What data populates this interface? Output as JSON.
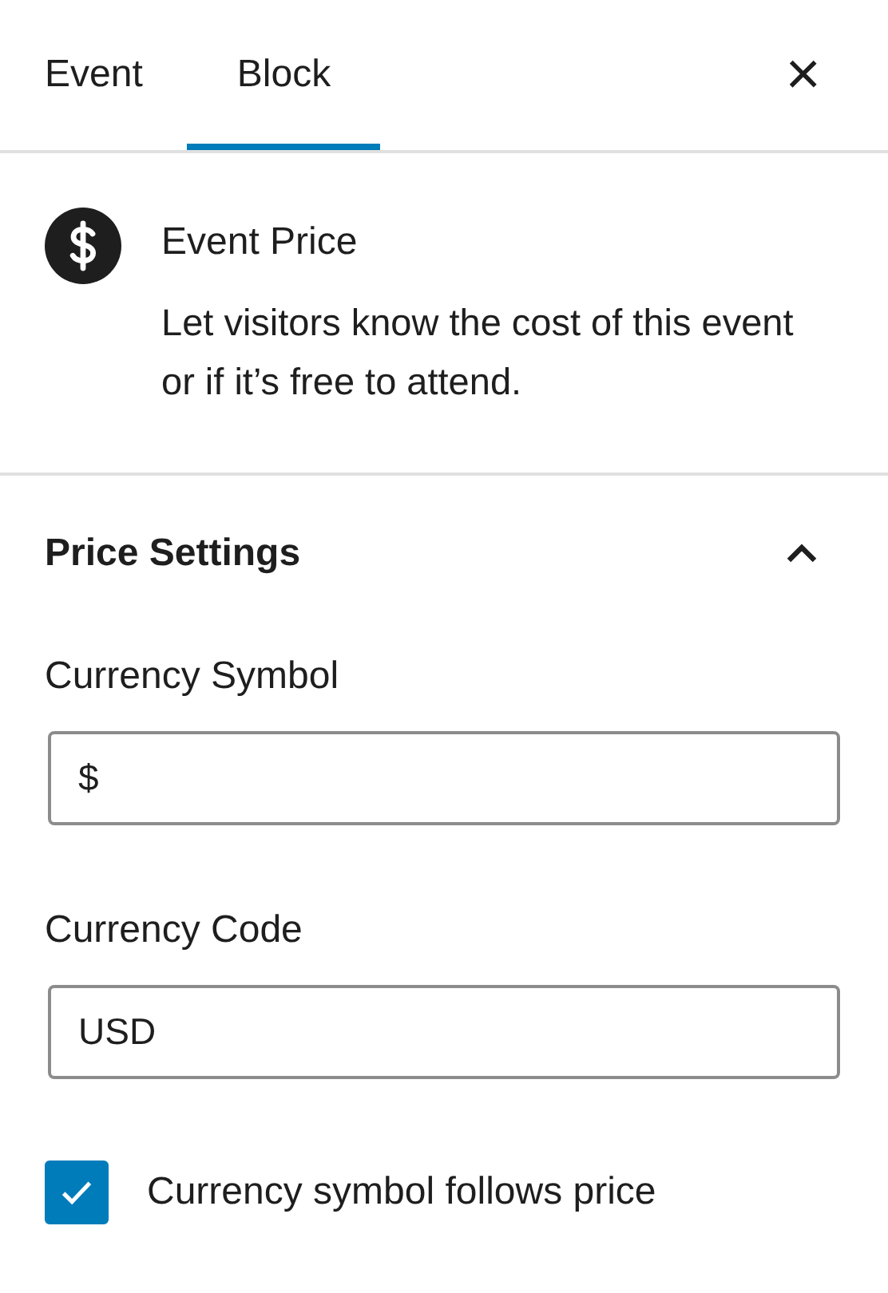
{
  "tabs": [
    {
      "label": "Event",
      "selected": false
    },
    {
      "label": "Block",
      "selected": true
    }
  ],
  "close": {
    "glyph": "×"
  },
  "block": {
    "title": "Event Price",
    "description": "Let visitors know the cost of this event or if it’s free to attend."
  },
  "panel": {
    "title": "Price Settings",
    "expanded": true,
    "fields": [
      {
        "label": "Currency Symbol",
        "value": "$"
      },
      {
        "label": "Currency Code",
        "value": "USD"
      }
    ],
    "checkbox": {
      "label": "Currency symbol follows price",
      "checked": true
    }
  }
}
